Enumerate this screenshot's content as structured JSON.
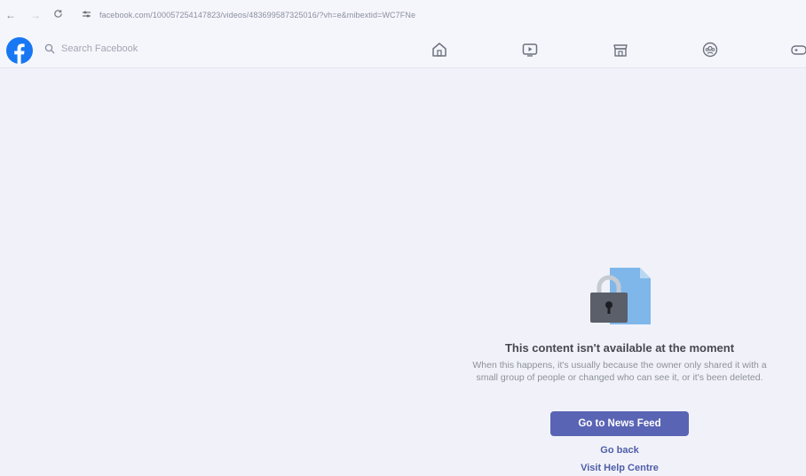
{
  "browser": {
    "back_icon": "←",
    "forward_icon": "→",
    "reload_icon": "C",
    "site_info_icon": "site-settings-icon",
    "url": "facebook.com/100057254147823/videos/483699587325016/?vh=e&mibextid=WC7FNe"
  },
  "header": {
    "logo": "facebook-logo",
    "search_placeholder": "Search Facebook",
    "nav": [
      "home-icon",
      "video-icon",
      "marketplace-icon",
      "groups-icon",
      "gaming-icon"
    ],
    "brand_color": "#1877f2"
  },
  "content": {
    "title": "This content isn't available at the moment",
    "description": "When this happens, it's usually because the owner only shared it with a small group of people or changed who can see it, or it's been deleted.",
    "primary_button": "Go to News Feed",
    "go_back": "Go back",
    "help_link": "Visit Help Centre",
    "accent_color": "#5a64b4"
  }
}
